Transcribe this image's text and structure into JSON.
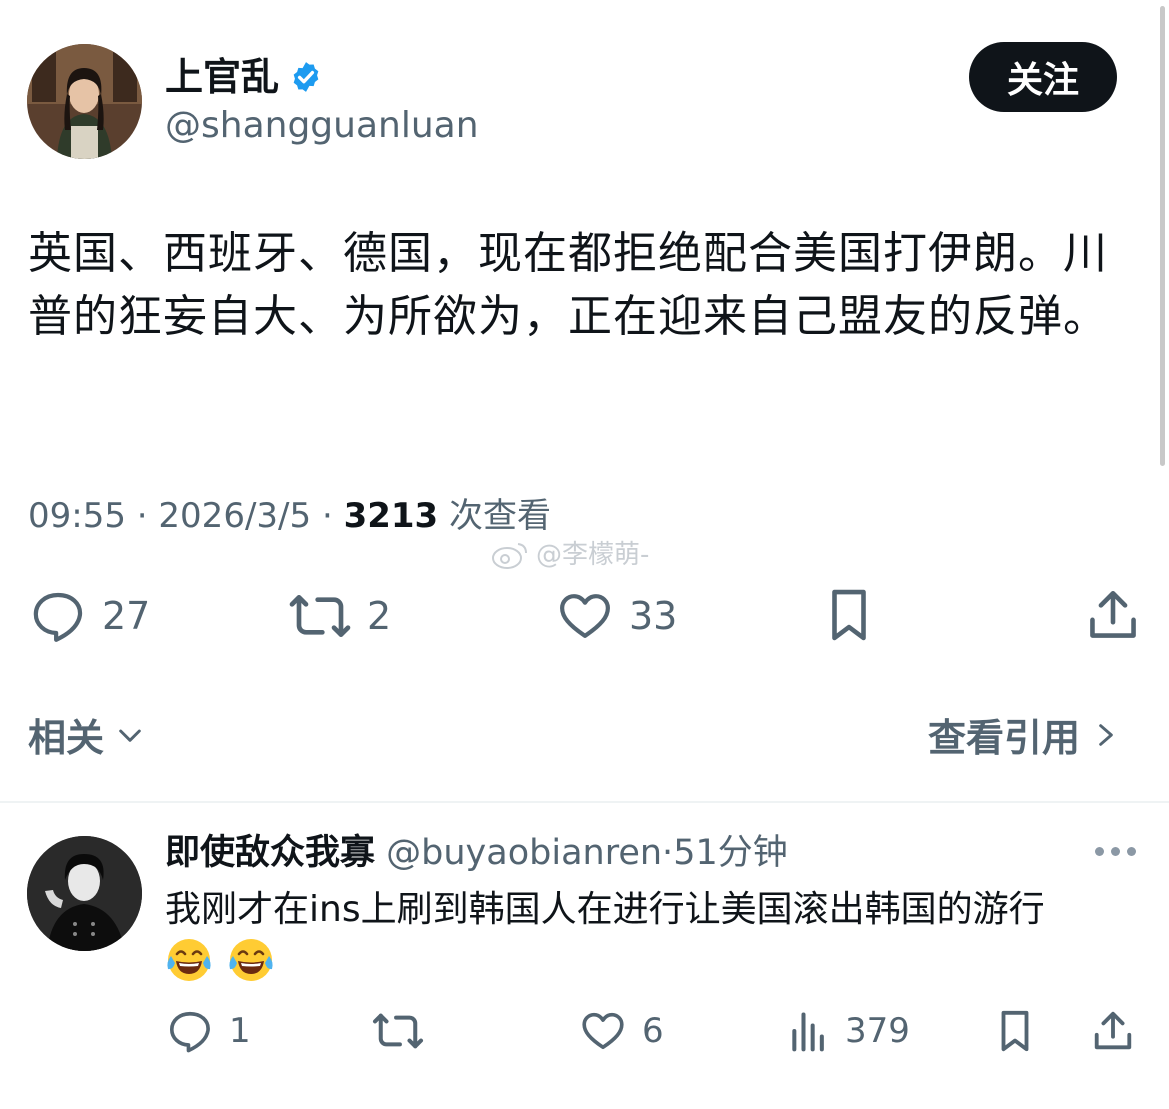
{
  "tweet": {
    "author_name": "上官乱",
    "author_handle": "@shangguanluan",
    "follow_label": "关注",
    "text": "英国、西班牙、德国，现在都拒绝配合美国打伊朗。川普的狂妄自大、为所欲为，正在迎来自己盟友的反弹。",
    "time": "09:55",
    "date": "2026/3/5",
    "views": "3213",
    "views_label": "次查看",
    "separator": "·",
    "watermark": "@李檬萌-",
    "actions": {
      "replies": "27",
      "retweets": "2",
      "likes": "33"
    }
  },
  "related_label": "相关",
  "view_quotes_label": "查看引用",
  "reply": {
    "author_name": "即使敌众我寡",
    "author_handle": "@buyaobianren",
    "time_sep": "·",
    "time": "51分钟",
    "text": "我刚才在ins上刷到韩国人在进行让美国滚出韩国的游行",
    "emojis": [
      "face-with-tears-of-joy",
      "face-with-tears-of-joy"
    ],
    "actions": {
      "replies": "1",
      "likes": "6",
      "views": "379"
    }
  },
  "colors": {
    "accent": "#1d9bf0",
    "text": "#0f1419",
    "secondary": "#536471"
  }
}
